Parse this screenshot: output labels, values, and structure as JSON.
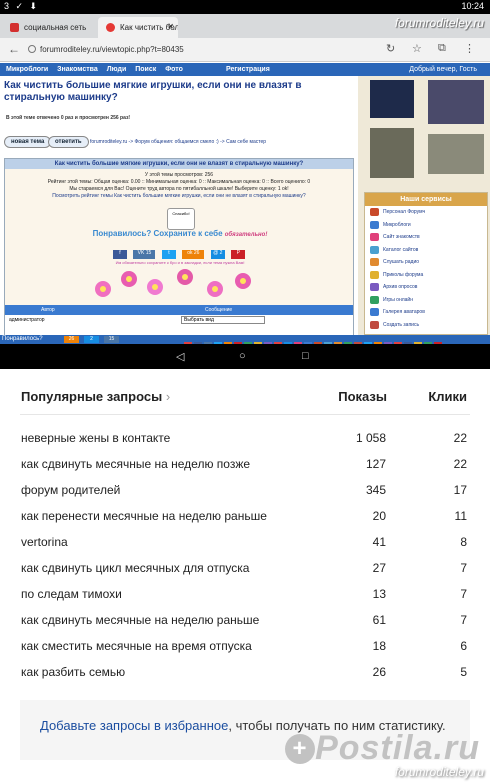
{
  "status_bar": {
    "left": "3 ✓ ⬇",
    "time": "10:24"
  },
  "browser": {
    "tabs": [
      {
        "label": "социальная сеть",
        "color": "#d32f2f"
      },
      {
        "label": "Как чистить боль",
        "color": "#e53935"
      }
    ],
    "watermark": "forumroditeley.ru",
    "url": "forumroditeley.ru/viewtopic.php?t=80435"
  },
  "site": {
    "menu": [
      "Микроблоги",
      "Знакомства",
      "Люди",
      "Поиск",
      "Фото"
    ],
    "register": "Регистрация",
    "greeting": "Добрый вечер, Гость",
    "title": "Как чистить большие мягкие игрушки, если они не влазят в стиральную машинку?",
    "viewed_note": "В этой теме отвечено 0 раз и просмотрен 256 раз!",
    "new_topic": "новая тема",
    "reply": "ответить",
    "breadcrumb": "forumroditeley.ru -> Форум общения: общаемся смело :) -> Сам себе мастер",
    "topic_header": "Как чистить большие мягкие игрушки, если они не влазят в стиральную машинку?",
    "stats": [
      "У этой темы просмотров: 256",
      "Рейтинг этой темы: Общая оценка: 0.00 :: Минимальная оценка: 0 :: Максимальная оценка: 0 :: Всего оценило: 0",
      "Мы стараемся для Вас! Оцените труд автора по пятибалльной шкале! Выберите оценку: 1 ok!",
      "Посмотреть рейтинг темы Как чистить большие мягкие игрушки, если они не влазят в стиральную машинку?"
    ],
    "clap_label": "Спасибо!",
    "save_prompt": "Понравилось? Сохраните к себе",
    "save_must": "обязательно!",
    "social": [
      {
        "label": "f",
        "color": "#3b5998"
      },
      {
        "label": "VK 15",
        "color": "#4a76a8"
      },
      {
        "label": "t",
        "color": "#1da1f2"
      },
      {
        "label": "ok 26",
        "color": "#ee8208"
      },
      {
        "label": "@ 2",
        "color": "#168de2"
      },
      {
        "label": "P",
        "color": "#cb2027"
      }
    ],
    "tip": "Им обязательно сохраните к бро и в закладки, если тема нужна Вам!",
    "col_author": "Автор",
    "col_message": "Сообщение",
    "last_user": "администратор",
    "select_value": "Выбрать вид",
    "services_title": "Наши сервисы",
    "services": [
      {
        "label": "Персонал Форумч",
        "color": "#c94a2a"
      },
      {
        "label": "Микроблоги",
        "color": "#3a7ad0"
      },
      {
        "label": "Сайт знакомств",
        "color": "#e0407a"
      },
      {
        "label": "Каталог сайтов",
        "color": "#4aa0d0"
      },
      {
        "label": "Слушать радио",
        "color": "#e08a30"
      },
      {
        "label": "Приколы форума",
        "color": "#e0b030"
      },
      {
        "label": "Архив опросов",
        "color": "#7a5ac0"
      },
      {
        "label": "Игры онлайн",
        "color": "#30a060"
      },
      {
        "label": "Галерея аватаров",
        "color": "#3a7ad0"
      },
      {
        "label": "Создать запись",
        "color": "#c04a40"
      }
    ],
    "bottom_left": "Понравилось?",
    "bottom_buttons": [
      {
        "label": "26",
        "color": "#ee8208"
      },
      {
        "label": "2",
        "color": "#168de2"
      },
      {
        "label": "15",
        "color": "#4a76a8"
      }
    ]
  },
  "popular": {
    "heading": "Популярные запросы",
    "col_shows": "Показы",
    "col_clicks": "Клики",
    "rows": [
      {
        "query": "неверные жены в контакте",
        "shows": "1 058",
        "clicks": "22"
      },
      {
        "query": "как сдвинуть месячные на неделю позже",
        "shows": "127",
        "clicks": "22"
      },
      {
        "query": "форум родителей",
        "shows": "345",
        "clicks": "17"
      },
      {
        "query": "как перенести месячные на неделю раньше",
        "shows": "20",
        "clicks": "11"
      },
      {
        "query": "vertorina",
        "shows": "41",
        "clicks": "8"
      },
      {
        "query": "как сдвинуть цикл месячных для отпуска",
        "shows": "27",
        "clicks": "7"
      },
      {
        "query": "по следам тимохи",
        "shows": "13",
        "clicks": "7"
      },
      {
        "query": "как сдвинуть месячные на неделю раньше",
        "shows": "61",
        "clicks": "7"
      },
      {
        "query": "как сместить месячные на время отпуска",
        "shows": "18",
        "clicks": "6"
      },
      {
        "query": "как разбить семью",
        "shows": "26",
        "clicks": "5"
      }
    ],
    "note_link": "Добавьте запросы в избранное",
    "note_rest": ", чтобы получать по ним статистику.",
    "logo": "Postila.ru",
    "watermark": "forumroditeley.ru"
  }
}
